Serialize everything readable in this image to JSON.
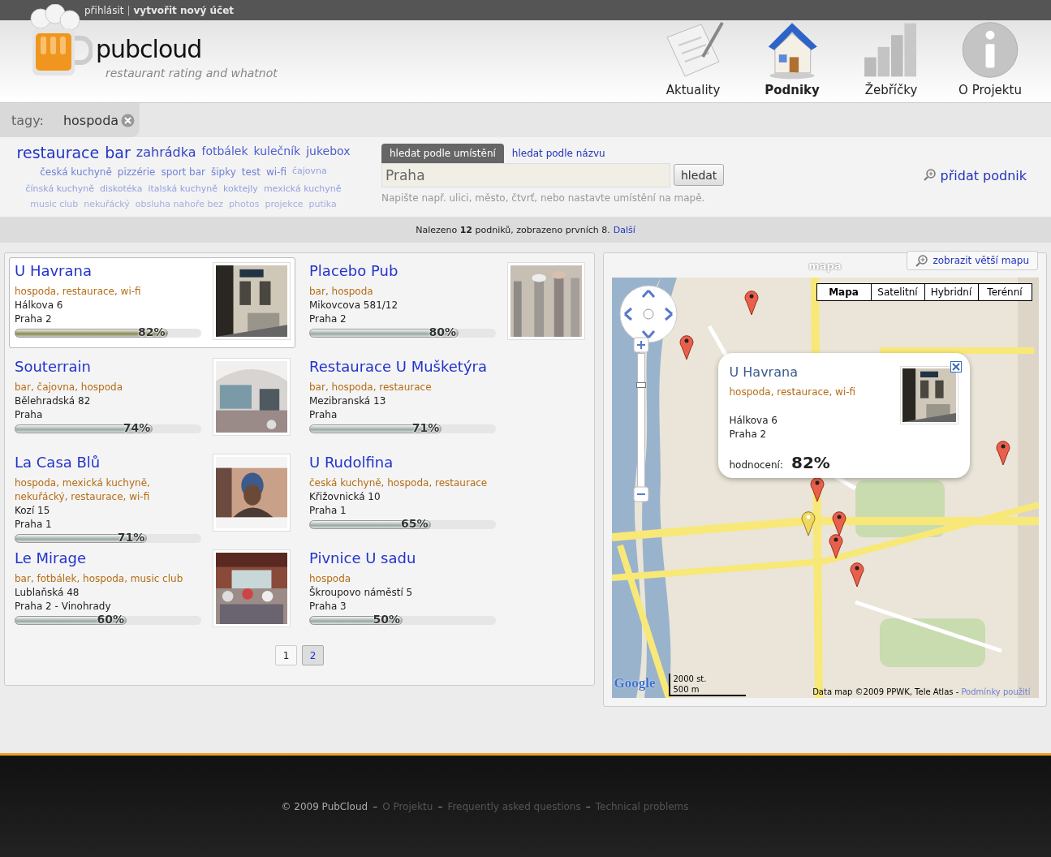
{
  "top_bar": {
    "login": "přihlásit",
    "separator": "|",
    "register": "vytvořit nový účet"
  },
  "logo": {
    "name": "pubcloud",
    "tagline": "restaurant rating and whatnot"
  },
  "nav": [
    {
      "label": "Aktuality",
      "kind": "news",
      "selected": false
    },
    {
      "label": "Podniky",
      "kind": "house",
      "selected": true
    },
    {
      "label": "Žebříčky",
      "kind": "chart",
      "selected": false
    },
    {
      "label": "O Projektu",
      "kind": "info",
      "selected": false
    }
  ],
  "tag_filter": {
    "label": "tagy:",
    "active_tag": "hospoda"
  },
  "tag_cloud": [
    {
      "label": "restaurace",
      "kind": "xl"
    },
    {
      "label": "bar",
      "kind": "xl"
    },
    {
      "label": "zahrádka",
      "kind": "l"
    },
    {
      "label": "fotbálek",
      "kind": "m"
    },
    {
      "label": "kulečník",
      "kind": "m"
    },
    {
      "label": "jukebox",
      "kind": "m"
    },
    {
      "label": "česká kuchyně",
      "kind": "s"
    },
    {
      "label": "pizzérie",
      "kind": "s"
    },
    {
      "label": "sport bar",
      "kind": "s"
    },
    {
      "label": "šipky",
      "kind": "s"
    },
    {
      "label": "test",
      "kind": "s"
    },
    {
      "label": "wi-fi",
      "kind": "s"
    },
    {
      "label": "čajovna",
      "kind": "xs"
    },
    {
      "label": "čínská kuchyně",
      "kind": "xs"
    },
    {
      "label": "diskotéka",
      "kind": "xs"
    },
    {
      "label": "italská kuchyně",
      "kind": "xs"
    },
    {
      "label": "koktejly",
      "kind": "xs"
    },
    {
      "label": "mexická kuchyně",
      "kind": "xs"
    },
    {
      "label": "music club",
      "kind": "xxs"
    },
    {
      "label": "nekuřácký",
      "kind": "xxs"
    },
    {
      "label": "obsluha nahoře bez",
      "kind": "xxs"
    },
    {
      "label": "photos",
      "kind": "xxs"
    },
    {
      "label": "projekce",
      "kind": "xxs"
    },
    {
      "label": "putika",
      "kind": "xxs"
    }
  ],
  "search": {
    "tabs": [
      {
        "label": "hledat podle umístění",
        "selected": true
      },
      {
        "label": "hledat podle názvu",
        "selected": false
      }
    ],
    "value": "Praha",
    "button": "hledat",
    "hint": "Napište např. ulici, město, čtvrť, nebo nastavte umístění na mapě."
  },
  "add_place": "přidat podnik",
  "results_summary": {
    "text": "Nalezeno **12** podniků, zobrazeno prvních 8.",
    "next": "Další"
  },
  "places": [
    {
      "name": "U Havrana",
      "tags": "hospoda, restaurace, wi-fi",
      "street": "Hálkova 6",
      "city": "Praha 2",
      "level": 0.82,
      "rating": "82%",
      "selected": true
    },
    {
      "name": "Placebo Pub",
      "tags": "bar, hospoda",
      "street": "Mikovcova 581/12",
      "city": "Praha 2",
      "level": 0.8,
      "rating": "80%",
      "selected": false
    },
    {
      "name": "Souterrain",
      "tags": "bar, čajovna, hospoda",
      "street": "Bělehradská 82",
      "city": "Praha",
      "level": 0.74,
      "rating": "74%",
      "selected": false
    },
    {
      "name": "Restaurace U Mušketýra",
      "tags": "bar, hospoda, restaurace",
      "street": "Mezibranská 13",
      "city": "Praha",
      "level": 0.71,
      "rating": "71%",
      "selected": false
    },
    {
      "name": "La Casa Blů",
      "tags": "hospoda, mexická kuchyně, nekuřácký, restaurace, wi-fi",
      "street": "Kozí 15",
      "city": "Praha 1",
      "level": 0.71,
      "rating": "71%",
      "selected": false
    },
    {
      "name": "U Rudolfina",
      "tags": "česká kuchyně, hospoda, restaurace",
      "street": "Křižovnická 10",
      "city": "Praha 1",
      "level": 0.65,
      "rating": "65%",
      "selected": false
    },
    {
      "name": "Le Mirage",
      "tags": "bar, fotbálek, hospoda, music club",
      "street": "Lublaňská 48",
      "city": "Praha 2 - Vinohrady",
      "level": 0.6,
      "rating": "60%",
      "selected": false
    },
    {
      "name": "Pivnice U sadu",
      "tags": "hospoda",
      "street": "Škroupovo náměstí 5",
      "city": "Praha 3",
      "level": 0.5,
      "rating": "50%",
      "selected": false
    }
  ],
  "pagination": [
    {
      "label": "1",
      "selected": false
    },
    {
      "label": "2",
      "selected": true
    }
  ],
  "map": {
    "title": "mapa",
    "enlarge_button": "zobrazit větší mapu",
    "types": [
      {
        "label": "Mapa",
        "selected": true
      },
      {
        "label": "Satelitní",
        "selected": false
      },
      {
        "label": "Hybridní",
        "selected": false
      },
      {
        "label": "Terénní",
        "selected": false
      }
    ],
    "pins": [
      {
        "selected": false
      },
      {
        "selected": false
      },
      {
        "selected": false
      },
      {
        "selected": false
      },
      {
        "selected": true
      },
      {
        "selected": false
      },
      {
        "selected": false
      },
      {
        "selected": false
      }
    ],
    "popup": {
      "name": "U Havrana",
      "tags": "hospoda, restaurace, wi-fi",
      "street": "Hálkova 6",
      "city": "Praha 2",
      "rating_label": "hodnocení:",
      "rating": "82%"
    },
    "zoom": {
      "level": 0.78
    },
    "scale": [
      "2000 st.",
      "500 m"
    ],
    "logo": "Google",
    "attribution": "Data map ©2009 PPWK, Tele Atlas - ",
    "terms": "Podmínky použití"
  },
  "footer": {
    "copyright": "© 2009 PubCloud",
    "separator": "–",
    "links": [
      "O Projektu",
      "Frequently asked questions",
      "Technical problems"
    ]
  }
}
